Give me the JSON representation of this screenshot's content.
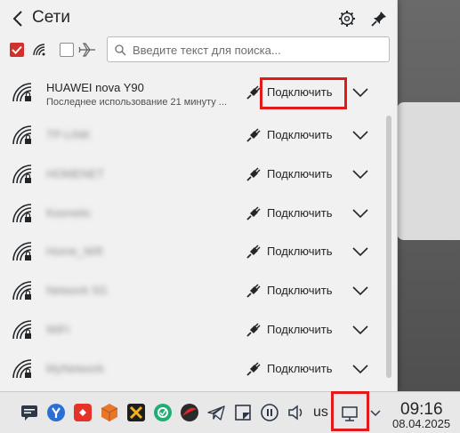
{
  "header": {
    "title": "Сети"
  },
  "toolbar": {
    "search_placeholder": "Введите текст для поиска..."
  },
  "networks": [
    {
      "name": "HUAWEI nova Y90",
      "subtitle": "Последнее использование 21 минуту ...",
      "action": "Подключить",
      "blurred": false
    },
    {
      "name": "TP-LINK",
      "action": "Подключить",
      "blurred": true
    },
    {
      "name": "HOMENET",
      "action": "Подключить",
      "blurred": true
    },
    {
      "name": "Keenetic",
      "action": "Подключить",
      "blurred": true
    },
    {
      "name": "Home_Wifi",
      "action": "Подключить",
      "blurred": true
    },
    {
      "name": "Network 5G",
      "action": "Подключить",
      "blurred": true
    },
    {
      "name": "WiFi",
      "action": "Подключить",
      "blurred": true
    },
    {
      "name": "MyNetwork",
      "action": "Подключить",
      "blurred": true
    }
  ],
  "taskbar": {
    "language": "us",
    "time": "09:16",
    "date": "08.04.2025"
  },
  "colors": {
    "highlight": "#e11b1b",
    "accent_checkbox": "#d0312d"
  }
}
